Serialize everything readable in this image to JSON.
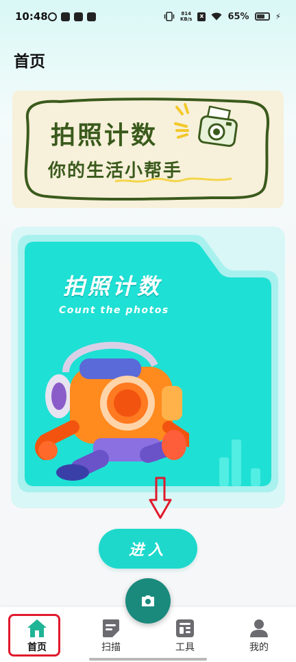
{
  "status_bar": {
    "time": "10:48",
    "speed_value": "814",
    "speed_unit": "KB/s",
    "battery": "65%",
    "battery_level": 0.65,
    "icons": [
      "notification-icon",
      "mail-icon",
      "message-icon",
      "tiktok-icon",
      "vibrate-icon",
      "no-sim-icon",
      "wifi-icon",
      "battery-icon",
      "charging-icon"
    ]
  },
  "page": {
    "title": "首页"
  },
  "banner": {
    "title": "拍照计数",
    "subtitle": "你的生活小帮手",
    "accent_color": "#3a5a1c",
    "background_color": "#f7f0da",
    "icon": "camera-illustration"
  },
  "hero": {
    "title": "拍照计数",
    "subtitle": "Count the photos",
    "background_color": "#1fe0d4",
    "illustration": "camera-mascot-running",
    "arrow": "down-arrow-icon"
  },
  "enter_button": {
    "label": "进入"
  },
  "bottom_nav": {
    "items": [
      {
        "label": "首页",
        "icon": "home-icon",
        "active": true
      },
      {
        "label": "扫描",
        "icon": "scan-icon",
        "active": false
      },
      {
        "label": "工具",
        "icon": "tools-icon",
        "active": false
      },
      {
        "label": "我的",
        "icon": "profile-icon",
        "active": false
      }
    ],
    "fab_icon": "camera-icon",
    "active_color": "#1fb496",
    "highlight_color": "#e0192c"
  }
}
